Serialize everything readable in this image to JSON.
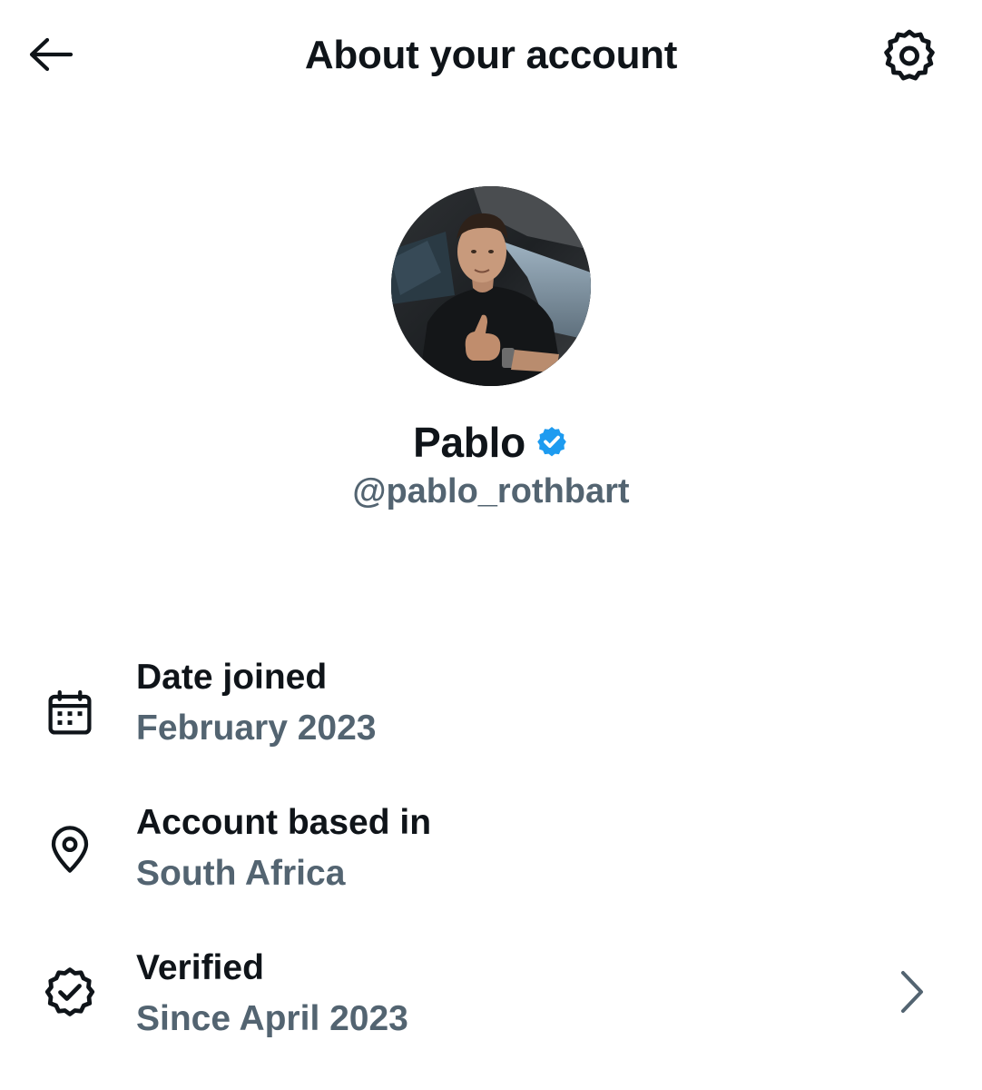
{
  "header": {
    "title": "About your account",
    "back_icon": "arrow-left-icon",
    "settings_icon": "gear-icon"
  },
  "profile": {
    "display_name": "Pablo",
    "handle": "@pablo_rothbart",
    "verified_badge_icon": "verified-badge-icon",
    "verified_badge_color": "#1d9bf0",
    "avatar_description": "profile photo"
  },
  "details": [
    {
      "icon": "calendar-icon",
      "label": "Date joined",
      "value": "February 2023"
    },
    {
      "icon": "location-pin-icon",
      "label": "Account based in",
      "value": "South Africa"
    },
    {
      "icon": "verified-check-icon",
      "label": "Verified",
      "value": "Since April 2023",
      "chevron_icon": "chevron-right-icon"
    }
  ],
  "colors": {
    "primary_text": "#0f1419",
    "secondary_text": "#536471",
    "accent": "#1d9bf0",
    "background": "#ffffff"
  }
}
